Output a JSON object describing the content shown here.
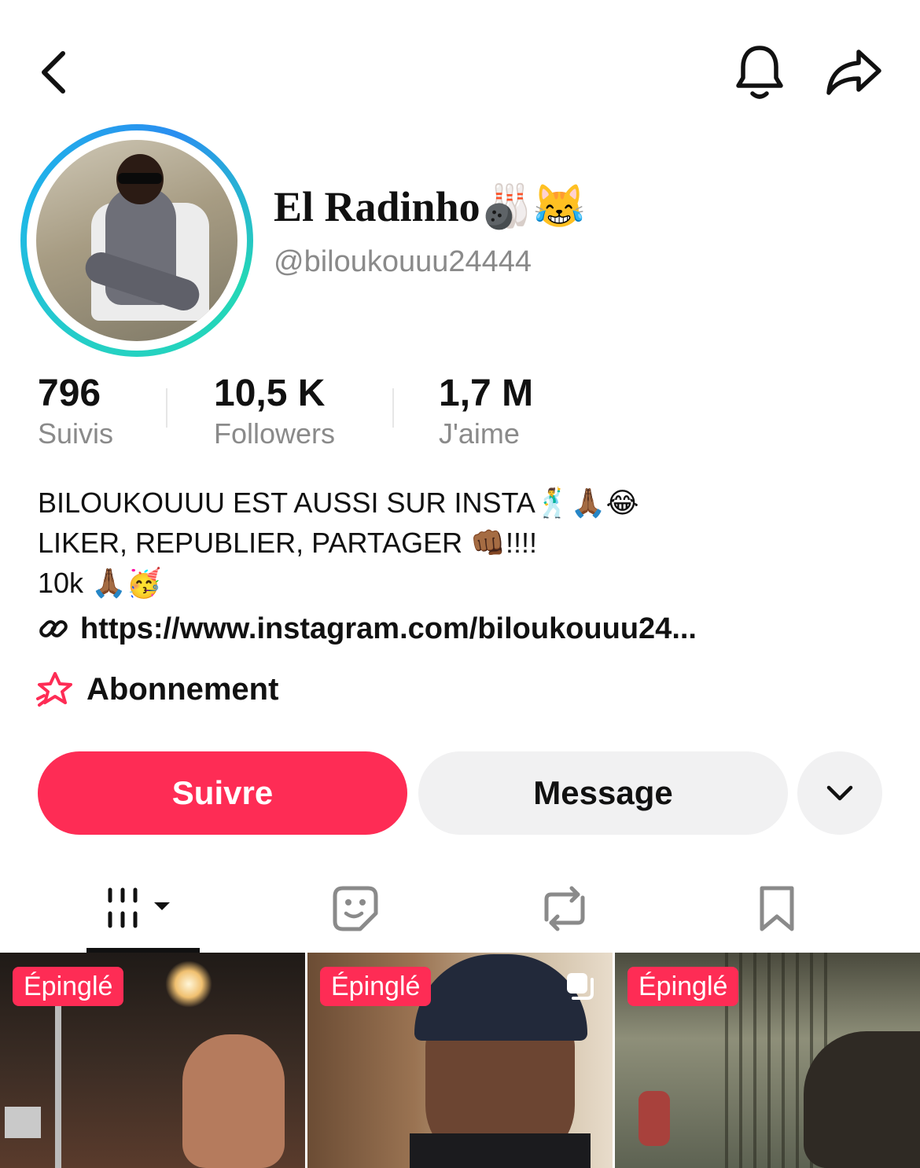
{
  "topbar": {
    "back_icon": "chevron-left-icon",
    "bell_icon": "bell-icon",
    "share_icon": "share-arrow-icon"
  },
  "profile": {
    "display_name": "El Radinho🎳😹",
    "username": "@biloukouuu24444"
  },
  "stats": [
    {
      "value": "796",
      "label": "Suivis"
    },
    {
      "value": "10,5 K",
      "label": "Followers"
    },
    {
      "value": "1,7 M",
      "label": "J'aime"
    }
  ],
  "bio": {
    "lines": [
      "BILOUKOUUU EST AUSSI SUR INSTA🕺🙏🏾😂",
      "LIKER, REPUBLIER, PARTAGER 👊🏾!!!!",
      "10k 🙏🏾🥳"
    ],
    "link": "https://www.instagram.com/biloukouuu24...",
    "link_icon": "link-icon"
  },
  "subscription": {
    "label": "Abonnement",
    "icon": "star-subscription-icon"
  },
  "actions": {
    "follow_label": "Suivre",
    "message_label": "Message",
    "more_icon": "chevron-down-icon"
  },
  "tabs": [
    {
      "name": "videos",
      "icon": "grid-icon",
      "active": true
    },
    {
      "name": "stickers",
      "icon": "sticker-icon",
      "active": false
    },
    {
      "name": "reposts",
      "icon": "repost-icon",
      "active": false
    },
    {
      "name": "saved",
      "icon": "bookmark-icon",
      "active": false
    }
  ],
  "videos": [
    {
      "badge": "Épinglé"
    },
    {
      "badge": "Épinglé"
    },
    {
      "badge": "Épinglé"
    }
  ],
  "colors": {
    "accent": "#fe2c55",
    "secondary_button": "#f1f1f2",
    "muted_text": "#8a8a8a",
    "ring_gradient": [
      "#25d0c4",
      "#2a8ef0"
    ]
  }
}
